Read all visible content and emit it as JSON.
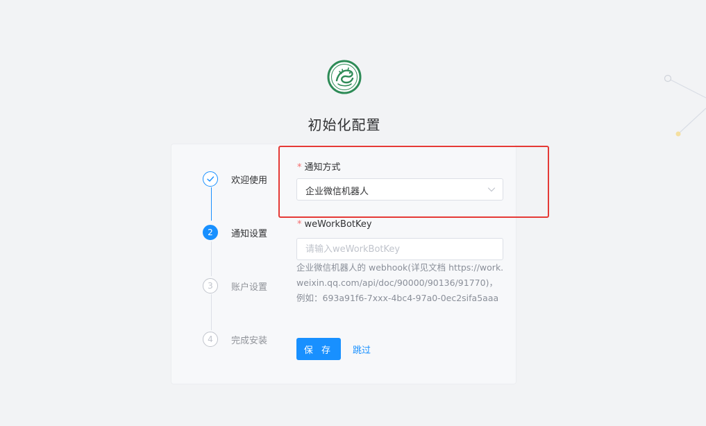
{
  "page": {
    "title": "初始化配置"
  },
  "steps": [
    {
      "number": "",
      "label": "欢迎使用",
      "status": "done"
    },
    {
      "number": "2",
      "label": "通知设置",
      "status": "active"
    },
    {
      "number": "3",
      "label": "账户设置",
      "status": "wait"
    },
    {
      "number": "4",
      "label": "完成安装",
      "status": "wait"
    }
  ],
  "form": {
    "notify_method": {
      "required_mark": "*",
      "label": "通知方式",
      "value": "企业微信机器人"
    },
    "bot_key": {
      "required_mark": "*",
      "label": "weWorkBotKey",
      "placeholder": "请输入weWorkBotKey",
      "value": "",
      "help": "企业微信机器人的 webhook(详见文档 https://work.weixin.qq.com/api/doc/90000/90136/91770)，例如：693a91f6-7xxx-4bc4-97a0-0ec2sifa5aaa"
    },
    "save_label": "保 存",
    "skip_label": "跳过"
  },
  "colors": {
    "primary": "#1890ff",
    "highlight": "#e53935",
    "logo_green": "#2e8b57"
  },
  "icons": {
    "logo": "dragon-logo-icon",
    "step1": "check-icon",
    "select": "chevron-down-icon"
  }
}
